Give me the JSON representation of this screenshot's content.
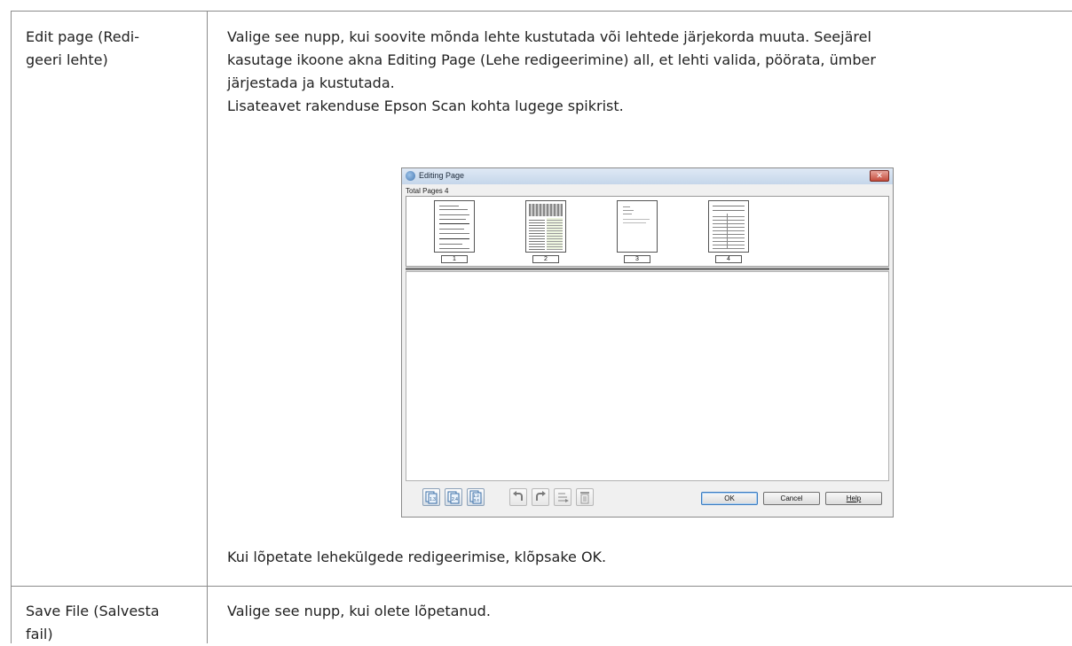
{
  "rows": [
    {
      "term": [
        "Edit page (Redi-",
        "geeri lehte)"
      ],
      "desc_lines": [
        "Valige see nupp, kui soovite mõnda lehte kustutada või lehtede järjekorda muuta. Seejärel",
        "kasutage ikoone akna Editing Page (Lehe redigeerimine) all, et lehti valida, pöörata, ümber",
        "järjestada ja kustutada.",
        "Lisateavet rakenduse Epson Scan kohta lugege spikrist."
      ],
      "after_text": "Kui lõpetate lehekülgede redigeerimise, klõpsake OK."
    },
    {
      "term": [
        "Save File (Salvesta",
        "fail)"
      ],
      "desc_lines": [
        "Valige see nupp, kui olete lõpetanud."
      ]
    }
  ],
  "dialog": {
    "title": "Editing Page",
    "total_pages": "Total Pages 4",
    "close_glyph": "✕",
    "pages": [
      {
        "label": "1",
        "style": "text"
      },
      {
        "label": "2",
        "style": "dense"
      },
      {
        "label": "3",
        "style": "sparse"
      },
      {
        "label": "4",
        "style": "form"
      }
    ],
    "toolbar_icons": [
      "select-odd-pages-icon",
      "select-even-pages-icon",
      "select-all-pages-icon",
      "rotate-left-icon",
      "rotate-right-icon",
      "reorder-pages-icon",
      "delete-page-icon"
    ],
    "buttons": {
      "ok": "OK",
      "cancel": "Cancel",
      "help": "Help"
    }
  }
}
